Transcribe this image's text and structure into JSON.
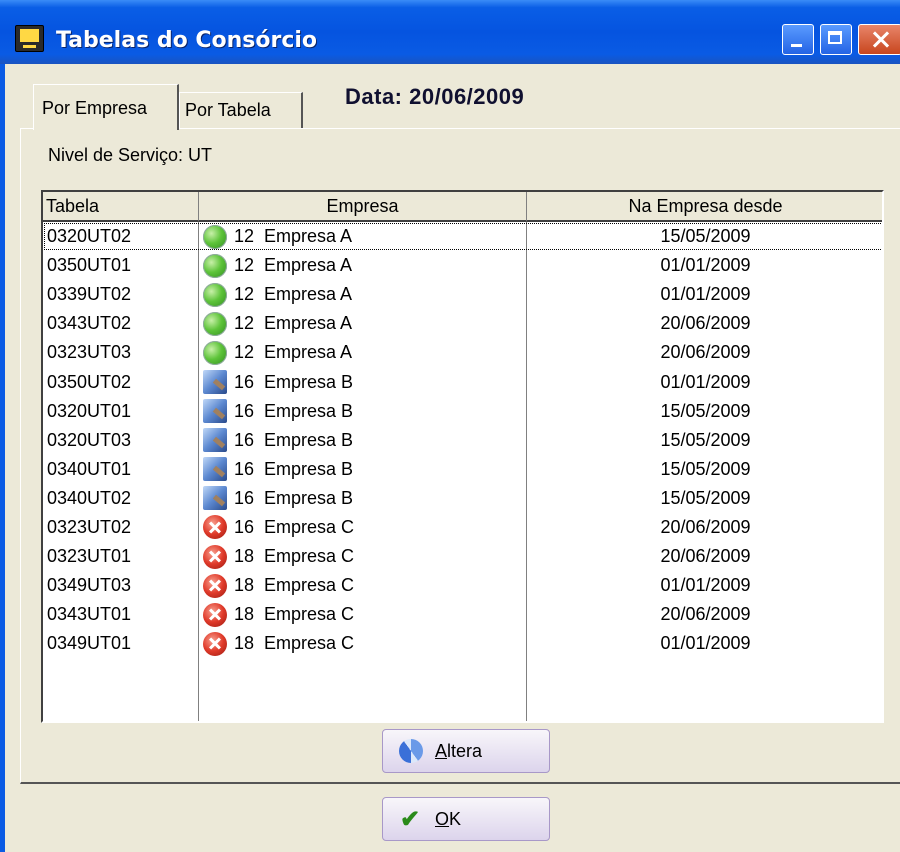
{
  "window": {
    "title": "Tabelas do Consórcio",
    "controls": [
      "minimize-icon",
      "maximize-icon",
      "close-icon"
    ],
    "title_bar_color": "#0A5EE6"
  },
  "tabs": [
    {
      "label": "Por Empresa",
      "active": true
    },
    {
      "label": "Por Tabela",
      "active": false
    }
  ],
  "header": {
    "date_label": "Data:  20/06/2009"
  },
  "panel": {
    "service_level_label": "Nivel de Serviço: UT"
  },
  "grid": {
    "columns": [
      "Tabela",
      "Empresa",
      "Na Empresa desde"
    ],
    "rows": [
      {
        "tabela": "0320UT02",
        "empresa": "12  Empresa A",
        "desde": "15/05/2009",
        "status": "green",
        "icon": "green-sphere-icon",
        "selected": true
      },
      {
        "tabela": "0350UT01",
        "empresa": "12  Empresa A",
        "desde": "01/01/2009",
        "status": "green",
        "icon": "green-sphere-icon"
      },
      {
        "tabela": "0339UT02",
        "empresa": "12  Empresa A",
        "desde": "01/01/2009",
        "status": "green",
        "icon": "green-sphere-icon"
      },
      {
        "tabela": "0343UT02",
        "empresa": "12  Empresa A",
        "desde": "20/06/2009",
        "status": "green",
        "icon": "green-sphere-icon"
      },
      {
        "tabela": "0323UT03",
        "empresa": "12  Empresa A",
        "desde": "20/06/2009",
        "status": "green",
        "icon": "green-sphere-icon"
      },
      {
        "tabela": "0350UT02",
        "empresa": "16  Empresa B",
        "desde": "01/01/2009",
        "status": "blue",
        "icon": "search-document-icon"
      },
      {
        "tabela": "0320UT01",
        "empresa": "16  Empresa B",
        "desde": "15/05/2009",
        "status": "blue",
        "icon": "search-document-icon"
      },
      {
        "tabela": "0320UT03",
        "empresa": "16  Empresa B",
        "desde": "15/05/2009",
        "status": "blue",
        "icon": "search-document-icon"
      },
      {
        "tabela": "0340UT01",
        "empresa": "16  Empresa B",
        "desde": "15/05/2009",
        "status": "blue",
        "icon": "search-document-icon"
      },
      {
        "tabela": "0340UT02",
        "empresa": "16  Empresa B",
        "desde": "15/05/2009",
        "status": "blue",
        "icon": "search-document-icon"
      },
      {
        "tabela": "0323UT02",
        "empresa": "16  Empresa C",
        "desde": "20/06/2009",
        "status": "red",
        "icon": "red-x-icon"
      },
      {
        "tabela": "0323UT01",
        "empresa": "18  Empresa C",
        "desde": "20/06/2009",
        "status": "red",
        "icon": "red-x-icon"
      },
      {
        "tabela": "0349UT03",
        "empresa": "18  Empresa C",
        "desde": "01/01/2009",
        "status": "red",
        "icon": "red-x-icon"
      },
      {
        "tabela": "0343UT01",
        "empresa": "18  Empresa C",
        "desde": "20/06/2009",
        "status": "red",
        "icon": "red-x-icon"
      },
      {
        "tabela": "0349UT01",
        "empresa": "18  Empresa C",
        "desde": "01/01/2009",
        "status": "red",
        "icon": "red-x-icon"
      }
    ]
  },
  "buttons": {
    "altera": {
      "mnemonic": "A",
      "rest": "ltera",
      "icon": "refresh-icon"
    },
    "ok": {
      "mnemonic": "O",
      "rest": "K",
      "icon": "checkmark-icon"
    }
  },
  "colors": {
    "dialog_bg": "#ECE9D8",
    "status_green": "#5EC43A",
    "status_blue": "#5C88D0",
    "status_red": "#E03A2A"
  }
}
